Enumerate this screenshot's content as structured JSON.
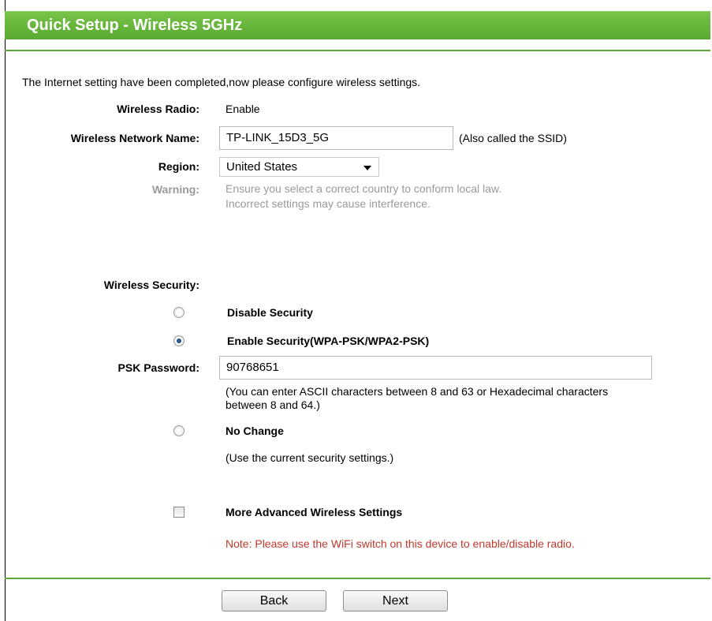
{
  "page": {
    "title": "Quick Setup - Wireless 5GHz",
    "intro": "The Internet setting have been completed,now please configure wireless settings."
  },
  "wireless_radio": {
    "label": "Wireless Radio:",
    "value": "Enable"
  },
  "network_name": {
    "label": "Wireless Network Name:",
    "value": "TP-LINK_15D3_5G",
    "hint": "(Also called the SSID)"
  },
  "region": {
    "label": "Region:",
    "selected": "United States"
  },
  "warning": {
    "label": "Warning:",
    "line1": "Ensure you select a correct country to conform local law.",
    "line2": "Incorrect settings may cause interference."
  },
  "security": {
    "label": "Wireless Security:",
    "selected": "enable",
    "disable_label": "Disable Security",
    "enable_label": "Enable Security(WPA-PSK/WPA2-PSK)",
    "psk_label": "PSK Password:",
    "psk_value": "90768651",
    "psk_hint_line1": "(You can enter ASCII characters between 8 and 63 or Hexadecimal characters",
    "psk_hint_line2": "between 8 and 64.)",
    "nochange_label": "No Change",
    "nochange_hint": "(Use the current security settings.)"
  },
  "advanced": {
    "label": "More Advanced Wireless Settings",
    "checked": false
  },
  "note": "Note: Please use the WiFi switch on this device to enable/disable radio.",
  "buttons": {
    "back": "Back",
    "next": "Next"
  },
  "colors": {
    "header_green": "#5aa930",
    "note_red": "#c0392b",
    "warning_gray": "#9a9a9a"
  }
}
